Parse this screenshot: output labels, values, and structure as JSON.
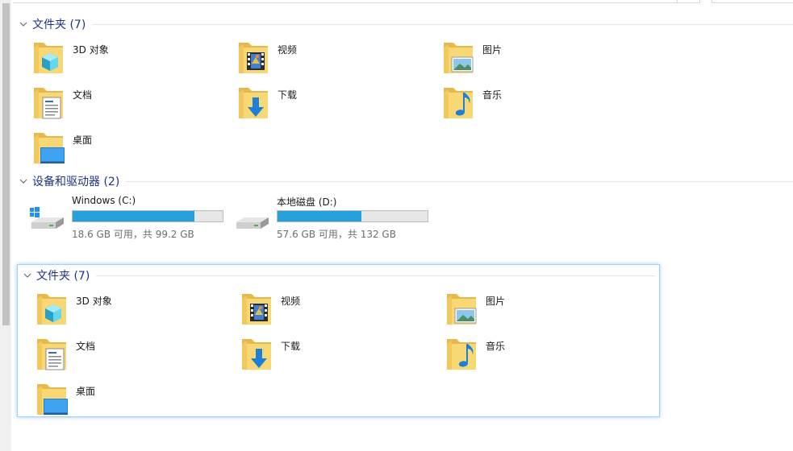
{
  "sections": {
    "folders_1": {
      "title": "文件夹 (7)",
      "items": [
        {
          "label": "3D 对象",
          "icon": "3d-objects-folder-icon"
        },
        {
          "label": "视频",
          "icon": "videos-folder-icon"
        },
        {
          "label": "图片",
          "icon": "pictures-folder-icon"
        },
        {
          "label": "文档",
          "icon": "documents-folder-icon"
        },
        {
          "label": "下载",
          "icon": "downloads-folder-icon"
        },
        {
          "label": "音乐",
          "icon": "music-folder-icon"
        },
        {
          "label": "桌面",
          "icon": "desktop-folder-icon"
        }
      ]
    },
    "drives": {
      "title": "设备和驱动器 (2)",
      "items": [
        {
          "name": "Windows (C:)",
          "info": "18.6 GB 可用，共 99.2 GB",
          "used_fraction": 0.81,
          "icon": "windows-drive-icon"
        },
        {
          "name": "本地磁盘 (D:)",
          "info": "57.6 GB 可用，共 132 GB",
          "used_fraction": 0.56,
          "icon": "hard-drive-icon"
        }
      ]
    },
    "folders_2": {
      "title": "文件夹 (7)",
      "items": [
        {
          "label": "3D 对象",
          "icon": "3d-objects-folder-icon"
        },
        {
          "label": "视频",
          "icon": "videos-folder-icon"
        },
        {
          "label": "图片",
          "icon": "pictures-folder-icon"
        },
        {
          "label": "文档",
          "icon": "documents-folder-icon"
        },
        {
          "label": "下载",
          "icon": "downloads-folder-icon"
        },
        {
          "label": "音乐",
          "icon": "music-folder-icon"
        },
        {
          "label": "桌面",
          "icon": "desktop-folder-icon"
        }
      ]
    }
  },
  "colors": {
    "section_title": "#1e3287",
    "drive_bar_fill": "#26a0da",
    "selection_border": "#99d1ff",
    "folder_yellow": "#f8d775"
  }
}
